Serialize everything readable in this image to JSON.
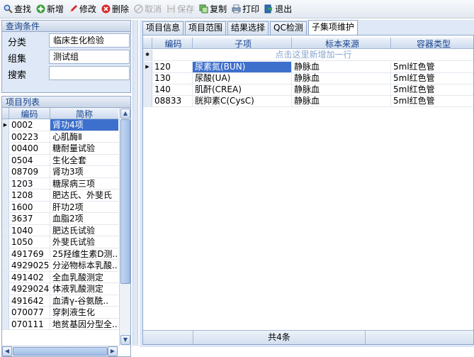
{
  "toolbar": {
    "buttons": [
      {
        "label": "查找",
        "icon": "search-icon",
        "enabled": true
      },
      {
        "label": "新增",
        "icon": "add-icon",
        "enabled": true
      },
      {
        "label": "修改",
        "icon": "edit-icon",
        "enabled": true
      },
      {
        "label": "删除",
        "icon": "delete-icon",
        "enabled": true
      },
      {
        "label": "取消",
        "icon": "cancel-icon",
        "enabled": false
      },
      {
        "label": "保存",
        "icon": "save-icon",
        "enabled": false
      },
      {
        "label": "复制",
        "icon": "copy-icon",
        "enabled": true
      },
      {
        "label": "打印",
        "icon": "print-icon",
        "enabled": true
      },
      {
        "label": "退出",
        "icon": "exit-icon",
        "enabled": true
      }
    ]
  },
  "query": {
    "title": "查询条件",
    "category_label": "分类",
    "category_value": "临床生化检验",
    "group_label": "组集",
    "group_value": "测试组",
    "search_label": "搜索",
    "search_value": ""
  },
  "item_list": {
    "title": "项目列表",
    "columns": [
      "编码",
      "简称"
    ],
    "rows": [
      [
        "0002",
        "肾功4项"
      ],
      [
        "00223",
        "心肌酶Ⅱ"
      ],
      [
        "00400",
        "糖耐量试验"
      ],
      [
        "0504",
        "生化全套"
      ],
      [
        "08709",
        "肾功3项"
      ],
      [
        "1203",
        "糖尿病三项"
      ],
      [
        "1208",
        "肥达氏、外斐氏"
      ],
      [
        "1600",
        "肝功2项"
      ],
      [
        "3637",
        "血脂2项"
      ],
      [
        "1040",
        "肥达氏试验"
      ],
      [
        "1050",
        "外斐氏试验"
      ],
      [
        "491769",
        "25羟维生素D测.."
      ],
      [
        "4929025",
        "分泌物标本乳酸.."
      ],
      [
        "491402",
        "全血乳酸测定"
      ],
      [
        "4929024",
        "体液乳酸测定"
      ],
      [
        "491642",
        "血清γ-谷氨酰.."
      ],
      [
        "070077",
        "穿刺液生化"
      ],
      [
        "070111",
        "地贫基因分型全.."
      ]
    ],
    "selected_index": 0
  },
  "tabs": [
    "项目信息",
    "项目范围",
    "结果选择",
    "QC检测",
    "子集项维护"
  ],
  "active_tab": 4,
  "subitems": {
    "columns": [
      "编码",
      "子项",
      "标本来源",
      "容器类型"
    ],
    "new_row_hint": "点击这里新增加一行",
    "rows": [
      [
        "120",
        "尿素氮(BUN)",
        "静脉血",
        "5ml红色管"
      ],
      [
        "130",
        "尿酸(UA)",
        "静脉血",
        "5ml红色管"
      ],
      [
        "140",
        "肌酐(CREA)",
        "静脉血",
        "5ml红色管"
      ],
      [
        "08833",
        "胱抑素C(CysC)",
        "静脉血",
        "5ml红色管"
      ]
    ],
    "selected_index": 0,
    "footer": "共4条"
  },
  "colors": {
    "selection": "#3d6fcc",
    "panel_header_text": "#15428b",
    "panel_background": "#dfe8f6"
  }
}
